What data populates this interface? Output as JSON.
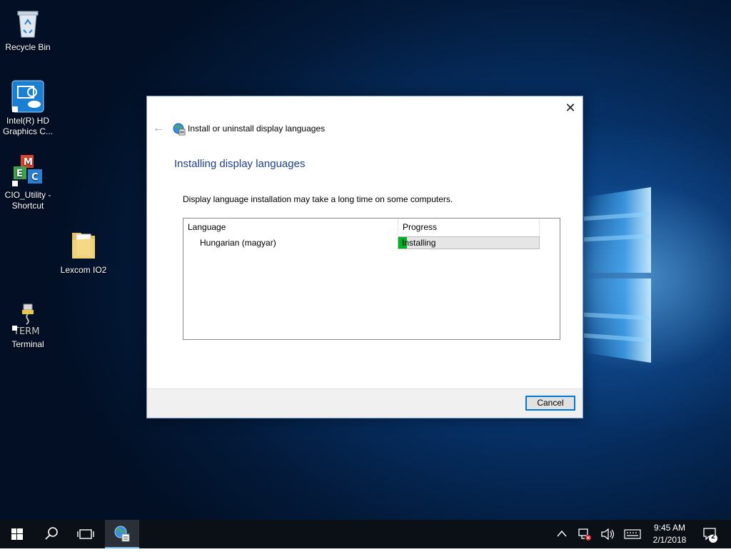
{
  "desktop": {
    "icons": [
      {
        "label_line1": "Recycle Bin",
        "label_line2": ""
      },
      {
        "label_line1": "Intel(R) HD",
        "label_line2": "Graphics C..."
      },
      {
        "label_line1": "CIO_Utility -",
        "label_line2": "Shortcut"
      },
      {
        "label_line1": "Lexcom IO2",
        "label_line2": ""
      },
      {
        "label_line1": "Terminal",
        "label_line2": ""
      }
    ]
  },
  "dialog": {
    "title": "Install or uninstall display languages",
    "heading": "Installing display languages",
    "description": "Display language installation may take a long time on some computers.",
    "close_glyph": "✕",
    "back_glyph": "←",
    "table": {
      "headers": {
        "language": "Language",
        "progress": "Progress"
      },
      "rows": [
        {
          "language": "Hungarian (magyar)",
          "status": "Installing",
          "progress_fraction": 0.06
        }
      ]
    },
    "cancel_label": "Cancel"
  },
  "taskbar": {
    "time": "9:45 AM",
    "date": "2/1/2018",
    "notification_count": "2"
  },
  "colors": {
    "accent": "#0078d7",
    "heading": "#1e3f8a",
    "progress_fill": "#06b025",
    "taskbar": "#0b0f16"
  }
}
